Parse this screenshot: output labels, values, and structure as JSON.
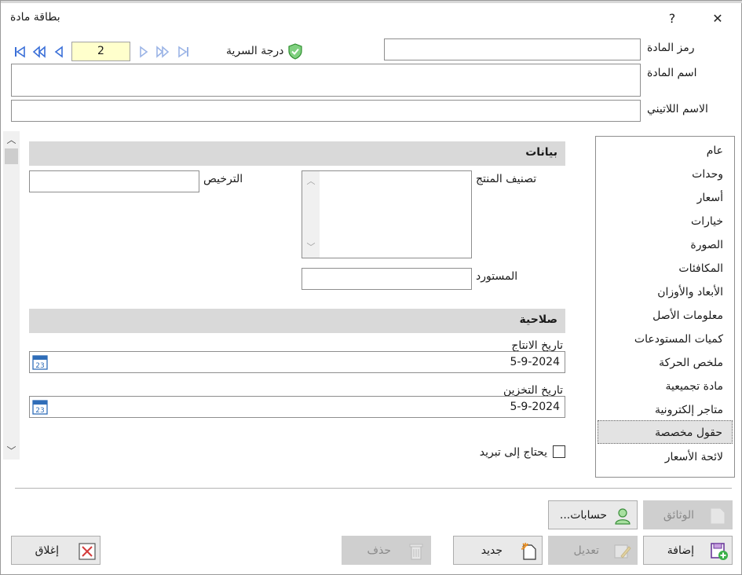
{
  "window": {
    "title": "بطاقة مادة",
    "help": "?",
    "close": "✕"
  },
  "navigator": {
    "record": "2",
    "secrecy_label": "درجة السرية"
  },
  "fields": {
    "code_label": "رمز المادة",
    "code_value": "",
    "name_label": "اسم المادة",
    "name_value": "",
    "latin_label": "الاسم اللاتيني",
    "latin_value": ""
  },
  "data_section": {
    "title": "بيانات",
    "classification_label": "تصنيف المنتج",
    "license_label": "الترخيص",
    "license_value": "",
    "importer_label": "المستورد",
    "importer_value": ""
  },
  "validity_section": {
    "title": "صلاحية",
    "production_label": "تاريخ الانتاج",
    "production_value": "5-9-2024",
    "storage_label": "تاريخ التخزين",
    "storage_value": "5-9-2024",
    "calendar_day": "23",
    "refrigeration_label": "يحتاج إلى تبريد"
  },
  "list": {
    "items": [
      {
        "label": "عام"
      },
      {
        "label": "وحدات"
      },
      {
        "label": "أسعار"
      },
      {
        "label": "خيارات"
      },
      {
        "label": "الصورة"
      },
      {
        "label": "المكافئات"
      },
      {
        "label": "الأبعاد والأوزان"
      },
      {
        "label": "معلومات الأصل"
      },
      {
        "label": "كميات المستودعات"
      },
      {
        "label": "ملخص الحركة"
      },
      {
        "label": "مادة تجميعية"
      },
      {
        "label": "متاجر إلكترونية"
      },
      {
        "label": "حقول مخصصة"
      },
      {
        "label": "لائحة الأسعار"
      }
    ],
    "selected": "حقول مخصصة"
  },
  "buttons": {
    "documents": "الوثائق",
    "accounts": "حسابات...",
    "add": "إضافة",
    "edit": "تعديل",
    "new": "جديد",
    "delete": "حذف",
    "close": "إغلاق"
  },
  "colors": {
    "record_bg": "#ffffcc",
    "section_bg": "#d9d9d9",
    "nav_icon": "#3a6fd8",
    "shield": "#3aa53a",
    "disabled_btn": "#cfcfcf"
  }
}
